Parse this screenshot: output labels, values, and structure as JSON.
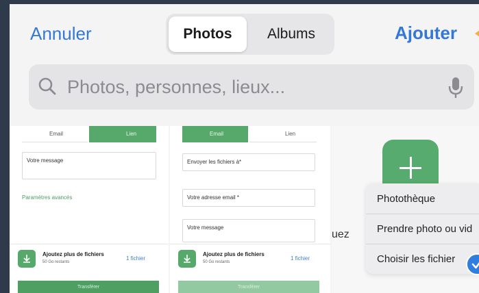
{
  "header": {
    "cancel_label": "Annuler",
    "segments": [
      "Photos",
      "Albums"
    ],
    "add_label": "Ajouter"
  },
  "search": {
    "placeholder": "Photos, personnes, lieux..."
  },
  "thumbnails": [
    {
      "tabs": [
        "Email",
        "Lien"
      ],
      "message_field": "Votre message",
      "advanced_link": "Paramètres avancés",
      "add_files_title": "Ajoutez plus de fichiers",
      "add_files_sub": "50 Go restants",
      "file_count": "1 fichier",
      "transfer_label": "Transférer"
    },
    {
      "tabs": [
        "Email",
        "Lien"
      ],
      "recipient_field": "Envoyer les fichiers à*",
      "email_field": "Votre adresse email *",
      "message_field": "Votre message",
      "add_files_title": "Ajoutez plus de fichiers",
      "add_files_sub": "50 Go restants",
      "file_count": "1 fichier",
      "transfer_label": "Transférer"
    },
    {
      "fragment_text": "uez",
      "menu": [
        "Photothèque",
        "Prendre photo ou vid",
        "Choisir les fichier"
      ]
    }
  ],
  "colors": {
    "accent": "#3478d6",
    "brand_green": "#56a96b",
    "check_blue": "#2f7ddc"
  }
}
